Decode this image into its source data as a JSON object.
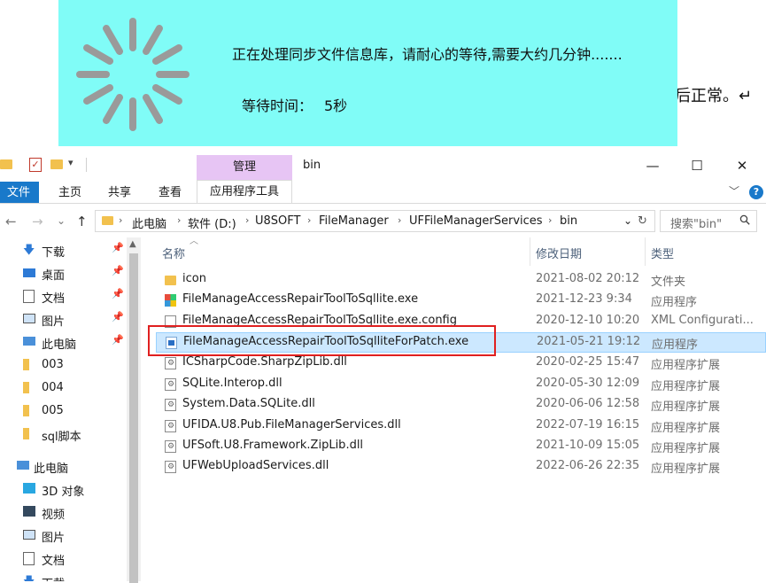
{
  "overlay": {
    "message": "正在处理同步文件信息库，请耐心的等待,需要大约几分钟.......",
    "wait_label": "等待时间：",
    "wait_value": "5秒",
    "spinner_icon": "loading-spinner-icon"
  },
  "background_doc_text": "后正常。↵",
  "titlebar": {
    "context_group": "管理",
    "folder_title": "bin",
    "minimize": "—",
    "maximize": "☐",
    "close": "✕"
  },
  "ribbon": {
    "tabs": [
      "文件",
      "主页",
      "共享",
      "查看"
    ],
    "context_tab": "应用程序工具",
    "accent": "#1979ca",
    "context_color": "#e7c5f4"
  },
  "address": {
    "back": "←",
    "forward": "→",
    "recent": "⌄",
    "up": "↑",
    "crumbs": [
      "此电脑",
      "软件 (D:)",
      "U8SOFT",
      "FileManager",
      "UFFileManagerServices",
      "bin"
    ],
    "dropdown": "⌄",
    "refresh": "↻",
    "search_placeholder": "搜索\"bin\""
  },
  "nav_pane": {
    "quick_access": [
      {
        "label": "下载",
        "icon": "download-icon",
        "pinned": true
      },
      {
        "label": "桌面",
        "icon": "desktop-icon",
        "pinned": true
      },
      {
        "label": "文档",
        "icon": "documents-icon",
        "pinned": true
      },
      {
        "label": "图片",
        "icon": "pictures-icon",
        "pinned": true
      },
      {
        "label": "此电脑",
        "icon": "this-pc-icon",
        "pinned": true
      },
      {
        "label": "003",
        "icon": "folder-icon",
        "pinned": false
      },
      {
        "label": "004",
        "icon": "folder-icon",
        "pinned": false
      },
      {
        "label": "005",
        "icon": "folder-icon",
        "pinned": false
      },
      {
        "label": "sql脚本",
        "icon": "folder-icon",
        "pinned": false
      }
    ],
    "this_pc": {
      "label": "此电脑",
      "children": [
        {
          "label": "3D 对象",
          "icon": "3d-objects-icon"
        },
        {
          "label": "视频",
          "icon": "videos-icon"
        },
        {
          "label": "图片",
          "icon": "pictures-icon"
        },
        {
          "label": "文档",
          "icon": "documents-icon"
        },
        {
          "label": "下载",
          "icon": "download-icon"
        }
      ]
    }
  },
  "file_list": {
    "columns": [
      "名称",
      "修改日期",
      "类型"
    ],
    "rows": [
      {
        "name": "icon",
        "date": "2021-08-02 20:12",
        "type": "文件夹",
        "icon": "folder-icon"
      },
      {
        "name": "FileManageAccessRepairToolToSqllite.exe",
        "date": "2021-12-23 9:34",
        "type": "应用程序",
        "icon": "app-multicolor-icon"
      },
      {
        "name": "FileManageAccessRepairToolToSqllite.exe.config",
        "date": "2020-12-10 10:20",
        "type": "XML Configurati...",
        "icon": "config-file-icon"
      },
      {
        "name": "FileManageAccessRepairToolToSqlliteForPatch.exe",
        "date": "2021-05-21 19:12",
        "type": "应用程序",
        "icon": "exe-icon",
        "selected": true
      },
      {
        "name": "ICSharpCode.SharpZipLib.dll",
        "date": "2020-02-25 15:47",
        "type": "应用程序扩展",
        "icon": "dll-icon"
      },
      {
        "name": "SQLite.Interop.dll",
        "date": "2020-05-30 12:09",
        "type": "应用程序扩展",
        "icon": "dll-icon"
      },
      {
        "name": "System.Data.SQLite.dll",
        "date": "2020-06-06 12:58",
        "type": "应用程序扩展",
        "icon": "dll-icon"
      },
      {
        "name": "UFIDA.U8.Pub.FileManagerServices.dll",
        "date": "2022-07-19 16:15",
        "type": "应用程序扩展",
        "icon": "dll-icon"
      },
      {
        "name": "UFSoft.U8.Framework.ZipLib.dll",
        "date": "2021-10-09 15:05",
        "type": "应用程序扩展",
        "icon": "dll-icon"
      },
      {
        "name": "UFWebUploadServices.dll",
        "date": "2022-06-26 22:35",
        "type": "应用程序扩展",
        "icon": "dll-icon"
      }
    ],
    "highlight_color": "#e02020"
  }
}
